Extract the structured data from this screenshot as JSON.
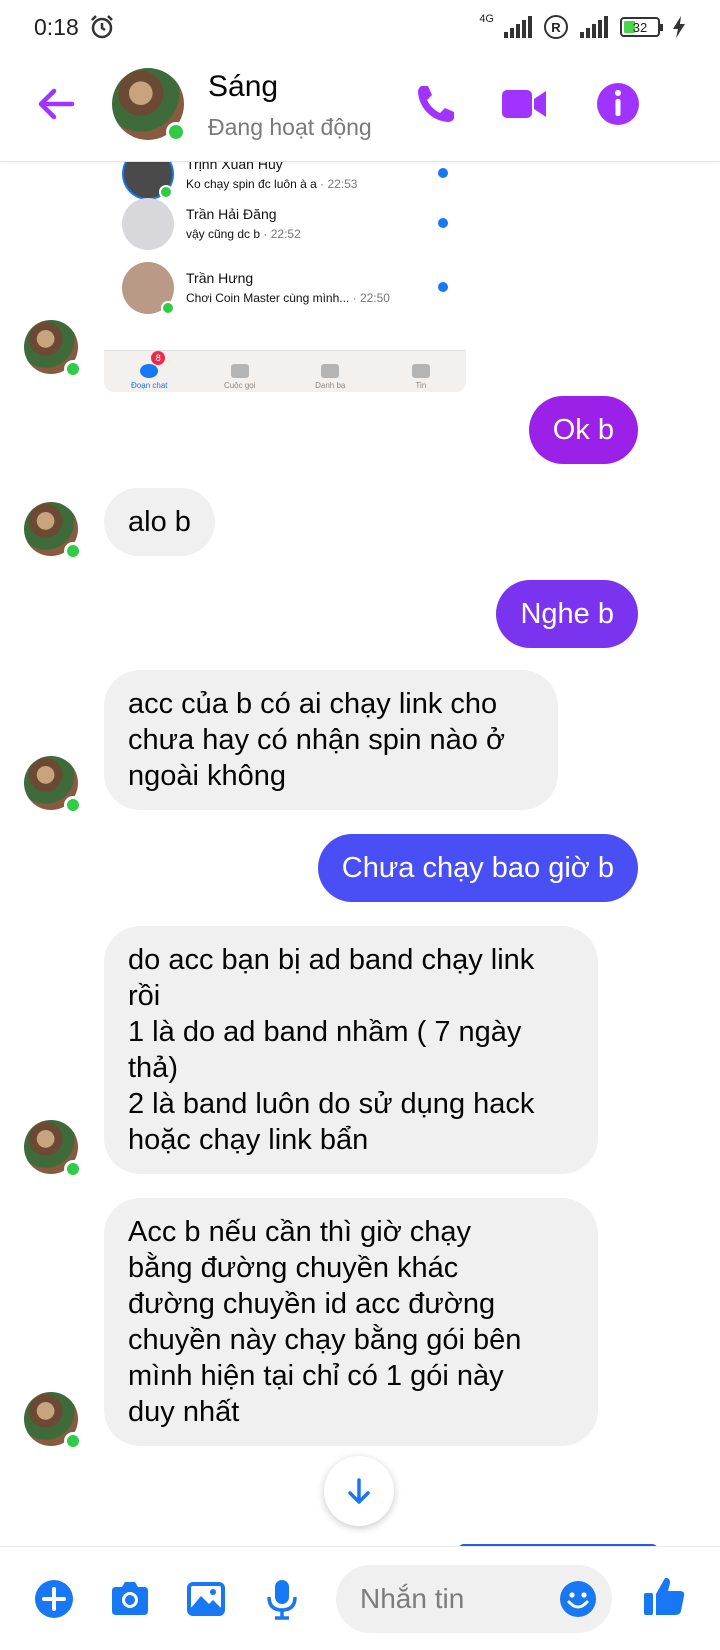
{
  "status_bar": {
    "time": "0:18",
    "network": "4G",
    "battery": "32"
  },
  "header": {
    "contact_name": "Sáng",
    "status": "Đang hoạt động"
  },
  "screenshot": {
    "rows": [
      {
        "name": "Trịnh Xuân Huy",
        "preview": "Ko chạy spin đc luôn à a",
        "time": "· 22:53"
      },
      {
        "name": "Trần Hải Đăng",
        "preview": "vậy cũng dc b",
        "time": "· 22:52"
      },
      {
        "name": "Trần Hưng",
        "preview": "Chơi Coin Master cùng mình...",
        "time": "· 22:50"
      }
    ],
    "tabs": [
      {
        "label": "Đoạn chat",
        "badge": "8"
      },
      {
        "label": "Cuộc gọi"
      },
      {
        "label": "Danh bạ"
      },
      {
        "label": "Tin"
      }
    ]
  },
  "messages": [
    {
      "side": "out",
      "text": "Ok b",
      "color": "#9b20e8"
    },
    {
      "side": "in",
      "text": "alo b"
    },
    {
      "side": "out",
      "text": "Nghe b",
      "color": "#7a34f0"
    },
    {
      "side": "in",
      "lines": [
        "acc của b có ai chạy link cho",
        "chưa hay có nhận spin nào ở",
        "ngoài không"
      ]
    },
    {
      "side": "out",
      "text": "Chưa chạy bao giờ b",
      "color": "#4a4ef5"
    },
    {
      "side": "in",
      "lines": [
        "do acc bạn bị ad band chạy link",
        "rồi",
        "1 là do ad band nhầm ( 7 ngày",
        "thả)",
        "2 là band luôn do sử dụng hack",
        "hoặc chạy link bẩn"
      ]
    },
    {
      "side": "in",
      "lines": [
        "Acc b nếu cần thì giờ chạy",
        "bằng đường chuyền khác",
        "đường chuyền id acc đường",
        "chuyền này chạy bằng gói bên",
        "mình hiện tại chỉ có 1 gói này",
        "duy nhất"
      ]
    }
  ],
  "composer": {
    "placeholder": "Nhắn tin"
  },
  "colors": {
    "accent": "#a033ff",
    "blue": "#1877f2",
    "online": "#31cc46"
  }
}
